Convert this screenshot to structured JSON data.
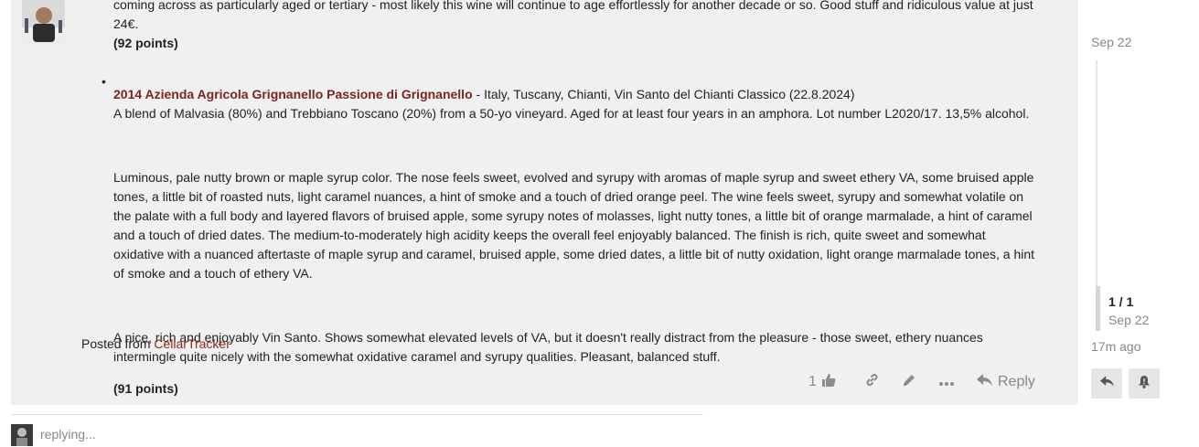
{
  "post": {
    "prev_text_line1": "coming across as particularly aged or tertiary - most likely this wine will continue to age effortlessly for another decade or so. Good stuff and ridiculous value at just",
    "prev_text_line2": "24€.",
    "prev_points": "(92 points)",
    "wine": {
      "title": "2014 Azienda Agricola Grignanello Passione di Grignanello",
      "region": " - Italy, Tuscany, Chianti, Vin Santo del Chianti Classico (22.8.2024)",
      "blend": "A blend of Malvasia (80%) and Trebbiano Toscano (20%) from a 50-yo vineyard. Aged for at least four years in an amphora. Lot number L2020/17. 13,5% alcohol.",
      "tasting": "Luminous, pale nutty brown or maple syrup color. The nose feels sweet, evolved and syrupy with aromas of maple syrup and sweet ethery VA, some bruised apple tones, a little bit of roasted nuts, light caramel nuances, a hint of smoke and a touch of dried orange peel. The wine feels sweet, syrupy and somewhat volatile on the palate with a full body and layered flavors of bruised apple, some syrupy notes of molasses, light nutty tones, a little bit of orange marmalade, a hint of caramel and a touch of dried dates. The medium-to-moderately high acidity keeps the overall feel enjoyably balanced. The finish is rich, quite sweet and somewhat oxidative with a nuanced aftertaste of maple syrup and caramel, bruised apple, some dried dates, a little bit of nutty oxidation, light orange marmalade tones, a hint of smoke and a touch of ethery VA.",
      "summary": "A nice, rich and enjoyably Vin Santo. Shows somewhat elevated levels of VA, but it doesn't really distract from the pleasure - those sweet, ethery nuances intermingle quite nicely with the somewhat oxidative caramel and syrupy qualities. Pleasant, balanced stuff.",
      "points": "(91 points)"
    },
    "posted_from_label": "Posted from ",
    "posted_from_link": "CellarTracker",
    "like_count": "1",
    "reply_label": "Reply"
  },
  "composer": {
    "status": "replying..."
  },
  "timeline": {
    "top_date": "Sep 22",
    "position": "1 / 1",
    "position_date": "Sep 22",
    "last_activity": "17m ago"
  },
  "icons": [
    "like-icon",
    "link-icon",
    "edit-icon",
    "more-icon",
    "reply-icon",
    "reply-back-icon",
    "notification-bell-icon"
  ],
  "colors": {
    "accent_link": "#8a2a22",
    "post_bg": "#f0f0f0"
  }
}
